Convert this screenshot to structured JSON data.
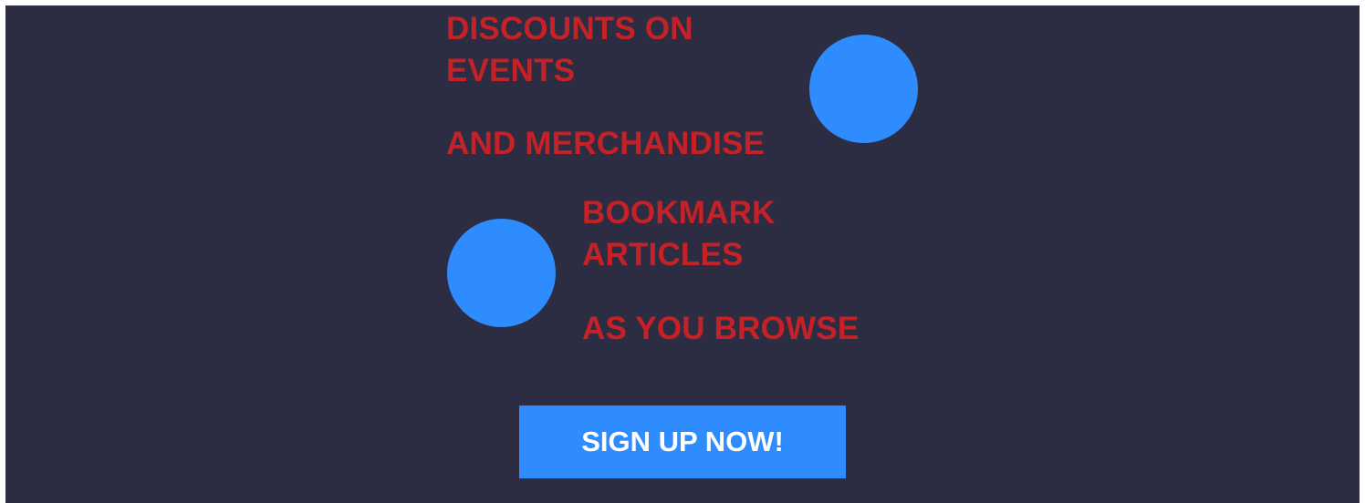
{
  "colors": {
    "background": "#2c2d42",
    "feature_text": "#c62126",
    "accent": "#2e8cfe",
    "button_text": "#ffffff"
  },
  "features": [
    {
      "line1": "DISCOUNTS ON",
      "line2": "EVENTS",
      "line3": "AND MERCHANDISE",
      "icon": "circle-icon"
    },
    {
      "line1": "BOOKMARK",
      "line2": "ARTICLES",
      "line3": "AS YOU BROWSE",
      "icon": "circle-icon"
    }
  ],
  "cta": {
    "label": "SIGN UP NOW!"
  }
}
